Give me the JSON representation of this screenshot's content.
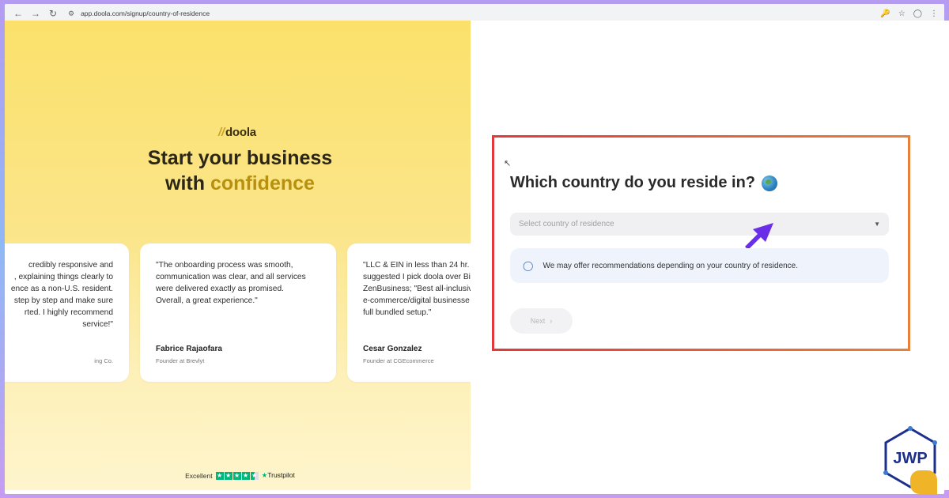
{
  "browser": {
    "url": "app.doola.com/signup/country-of-residence"
  },
  "left": {
    "logo_slashes": "//",
    "logo_text": "doola",
    "headline_line1": "Start your business",
    "headline_line2_plain": "with ",
    "headline_line2_accent": "confidence",
    "testimonials": [
      {
        "quote": "credibly responsive and\n, explaining things clearly to\nence as a non-U.S. resident.\nstep by step and make sure\nrted. I highly recommend\nservice!\"",
        "author": "",
        "role": "ing Co."
      },
      {
        "quote": "\"The onboarding process was smooth,\ncommunication was clear, and all services\nwere delivered exactly as promised.\nOverall, a great experience.\"",
        "author": "Fabrice Rajaofara",
        "role": "Founder at Brevlyt"
      },
      {
        "quote": "\"LLC & EIN in less than 24 hr.\nsuggested I pick doola over Bi\nZenBusiness; \"Best all-inclusiv\ne-commerce/digital businesse\nfull bundled setup.\"",
        "author": "Cesar Gonzalez",
        "role": "Founder at CGEcommerce"
      }
    ],
    "trust_label": "Excellent",
    "trust_brand": "Trustpilot",
    "trust_rating": 4.5
  },
  "form": {
    "question": "Which country do you reside in?",
    "select_placeholder": "Select country of residence",
    "info_text": "We may offer recommendations depending on your country of residence.",
    "next_label": "Next"
  },
  "badge": {
    "text": "JWP"
  },
  "colors": {
    "accent": "#b7900f",
    "highlight_border": "#e03a3a",
    "arrow": "#6a2ee8",
    "trustpilot_green": "#00b67a"
  }
}
